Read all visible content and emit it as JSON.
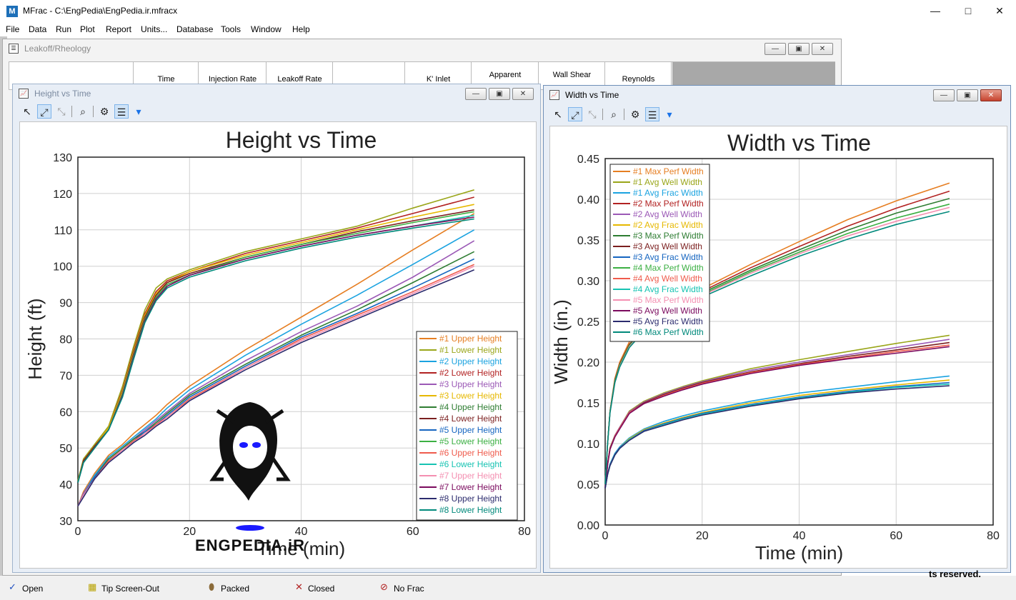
{
  "window": {
    "title": "MFrac - C:\\EngPedia\\EngPedia.ir.mfracx",
    "app_icon": "M"
  },
  "menu": [
    "File",
    "Data",
    "Run",
    "Plot",
    "Report",
    "Units...",
    "Database",
    "Tools",
    "Window",
    "Help"
  ],
  "leakoff": {
    "title": "Leakoff/Rheology",
    "columns": [
      "Time",
      "Injection Rate",
      "Leakoff Rate",
      "",
      "K' Inlet",
      "Apparent",
      "Wall Shear",
      "Reynolds"
    ]
  },
  "height_window": {
    "title": "Height vs Time",
    "chart_data": {
      "type": "line",
      "title": "Height vs Time",
      "xlabel": "Time (min)",
      "ylabel": "Height (ft)",
      "xlim": [
        0,
        80
      ],
      "ylim": [
        30,
        130
      ],
      "xticks": [
        "0",
        "20",
        "40",
        "60",
        "80"
      ],
      "yticks": [
        "30",
        "40",
        "50",
        "60",
        "70",
        "80",
        "90",
        "100",
        "110",
        "120",
        "130"
      ],
      "grid": true,
      "legend_position": "bottom-right",
      "x": [
        0,
        1,
        3,
        5.5,
        8,
        10,
        12,
        14,
        16,
        20,
        30,
        40,
        50,
        60,
        71
      ],
      "series": [
        {
          "name": "#1 Upper Height",
          "color": "#e67e22",
          "values": [
            34,
            38,
            43,
            48,
            51,
            54,
            56.5,
            59,
            62,
            67,
            77,
            86,
            95,
            104.5,
            114.5
          ]
        },
        {
          "name": "#1 Lower Height",
          "color": "#9aa61a",
          "values": [
            41,
            47,
            51,
            56,
            67,
            78,
            88,
            94,
            96.5,
            99,
            104,
            107.5,
            111,
            116,
            121
          ]
        },
        {
          "name": "#2 Upper Height",
          "color": "#1ba3e0",
          "values": [
            34,
            37.5,
            42.5,
            47.5,
            50.5,
            53,
            55.5,
            58,
            61,
            66,
            75.5,
            84,
            92,
            100.5,
            110
          ]
        },
        {
          "name": "#2 Lower Height",
          "color": "#b22222",
          "values": [
            40.5,
            46.5,
            50.5,
            55.5,
            66,
            77,
            87,
            93,
            96,
            98.5,
            103.5,
            107,
            110.5,
            114.5,
            119
          ]
        },
        {
          "name": "#3 Upper Height",
          "color": "#9b59b6",
          "values": [
            34,
            37.5,
            42,
            47,
            50,
            52.5,
            55,
            57.5,
            60,
            65,
            74,
            82,
            89,
            97,
            107
          ]
        },
        {
          "name": "#3 Lower Height",
          "color": "#e6b800",
          "values": [
            40.5,
            46.5,
            50.5,
            55.5,
            65.5,
            76.5,
            86.5,
            92.5,
            95.5,
            98.5,
            103,
            106.5,
            110,
            113.5,
            117
          ]
        },
        {
          "name": "#4 Upper Height",
          "color": "#2e7d32",
          "values": [
            34,
            37,
            42,
            47,
            50,
            52.5,
            54.5,
            57,
            59.5,
            64.5,
            73,
            81,
            88,
            95.5,
            104
          ]
        },
        {
          "name": "#4 Lower Height",
          "color": "#7b1f1f",
          "values": [
            40.5,
            46.5,
            50.5,
            55,
            65,
            76,
            86,
            92,
            95.5,
            98,
            102.5,
            106,
            109.5,
            112.5,
            115.5
          ]
        },
        {
          "name": "#5 Upper Height",
          "color": "#1565c0",
          "values": [
            34,
            37,
            42,
            46.5,
            49.5,
            52,
            54.5,
            56.5,
            59,
            64,
            72.5,
            80.5,
            87,
            94,
            102
          ]
        },
        {
          "name": "#5 Lower Height",
          "color": "#3cb043",
          "values": [
            40.5,
            46,
            50,
            55,
            65,
            75.5,
            85.5,
            91.5,
            95,
            97.5,
            102.5,
            106,
            109,
            112,
            115
          ]
        },
        {
          "name": "#6 Upper Height",
          "color": "#ef5b4c",
          "values": [
            34,
            37,
            41.5,
            46.5,
            49.5,
            52,
            54,
            56.5,
            58.5,
            63.5,
            72,
            80,
            86.5,
            93,
            100.5
          ]
        },
        {
          "name": "#6 Lower Height",
          "color": "#17c3b2",
          "values": [
            40.5,
            46,
            50,
            55,
            64.5,
            75,
            85,
            91,
            94.5,
            97.5,
            102,
            105.5,
            108.5,
            111,
            114
          ]
        },
        {
          "name": "#7 Upper Height",
          "color": "#f48fb1",
          "values": [
            34,
            37,
            41.5,
            46,
            49.5,
            51.5,
            54,
            56,
            58.5,
            63,
            72,
            79.5,
            86,
            92.5,
            100
          ]
        },
        {
          "name": "#7 Lower Height",
          "color": "#7b0a5e",
          "values": [
            40.5,
            46,
            50,
            55,
            64.5,
            75,
            85,
            91,
            94.5,
            97.5,
            102,
            105.5,
            108.5,
            111,
            113.5
          ]
        },
        {
          "name": "#8 Upper Height",
          "color": "#2c2c6e",
          "values": [
            34,
            36.5,
            41.5,
            46,
            49,
            51.5,
            53.5,
            56,
            58,
            63,
            71.5,
            79,
            85.5,
            92,
            99
          ]
        },
        {
          "name": "#8 Lower Height",
          "color": "#00897b",
          "values": [
            40.5,
            46,
            50,
            55,
            64,
            74.5,
            84.5,
            90.5,
            94,
            97,
            101.5,
            105,
            108,
            110.5,
            113
          ]
        }
      ]
    }
  },
  "width_window": {
    "title": "Width vs Time",
    "chart_data": {
      "type": "line",
      "title": "Width vs Time",
      "xlabel": "Time (min)",
      "ylabel": "Width (in.)",
      "xlim": [
        0,
        80
      ],
      "ylim": [
        0,
        0.45
      ],
      "xticks": [
        "0",
        "20",
        "40",
        "60",
        "80"
      ],
      "yticks": [
        "0.00",
        "0.05",
        "0.10",
        "0.15",
        "0.20",
        "0.25",
        "0.30",
        "0.35",
        "0.40",
        "0.45"
      ],
      "grid": true,
      "legend_position": "top-left",
      "x": [
        0,
        0.5,
        1,
        2,
        3,
        5,
        8,
        12,
        16,
        20,
        30,
        40,
        50,
        60,
        71
      ],
      "series": [
        {
          "name": "#1 Max Perf Width",
          "color": "#e67e22",
          "values": [
            0.05,
            0.1,
            0.14,
            0.18,
            0.2,
            0.225,
            0.245,
            0.26,
            0.275,
            0.29,
            0.32,
            0.348,
            0.375,
            0.398,
            0.42
          ]
        },
        {
          "name": "#1 Avg Well Width",
          "color": "#9aa61a",
          "values": [
            0.045,
            0.075,
            0.095,
            0.11,
            0.12,
            0.14,
            0.152,
            0.162,
            0.17,
            0.177,
            0.192,
            0.203,
            0.213,
            0.223,
            0.233
          ]
        },
        {
          "name": "#1 Avg Frac Width",
          "color": "#1ba3e0",
          "values": [
            0.045,
            0.063,
            0.075,
            0.088,
            0.096,
            0.107,
            0.118,
            0.127,
            0.134,
            0.14,
            0.152,
            0.162,
            0.169,
            0.176,
            0.183
          ]
        },
        {
          "name": "#2 Max Perf Width",
          "color": "#b22222",
          "values": [
            0.05,
            0.1,
            0.14,
            0.178,
            0.198,
            0.222,
            0.242,
            0.257,
            0.272,
            0.287,
            0.316,
            0.342,
            0.367,
            0.389,
            0.41
          ]
        },
        {
          "name": "#2 Avg Well Width",
          "color": "#9b59b6",
          "values": [
            0.045,
            0.075,
            0.094,
            0.11,
            0.12,
            0.139,
            0.151,
            0.161,
            0.169,
            0.176,
            0.19,
            0.2,
            0.209,
            0.218,
            0.228
          ]
        },
        {
          "name": "#2 Avg Frac Width",
          "color": "#e6b800",
          "values": [
            0.045,
            0.063,
            0.074,
            0.087,
            0.095,
            0.106,
            0.117,
            0.125,
            0.132,
            0.138,
            0.15,
            0.159,
            0.166,
            0.172,
            0.178
          ]
        },
        {
          "name": "#3 Max Perf Width",
          "color": "#2e7d32",
          "values": [
            0.05,
            0.1,
            0.139,
            0.177,
            0.197,
            0.221,
            0.241,
            0.256,
            0.27,
            0.285,
            0.313,
            0.338,
            0.362,
            0.383,
            0.401
          ]
        },
        {
          "name": "#3 Avg Well Width",
          "color": "#7b1f1f",
          "values": [
            0.045,
            0.075,
            0.094,
            0.109,
            0.119,
            0.138,
            0.15,
            0.16,
            0.168,
            0.175,
            0.188,
            0.198,
            0.207,
            0.215,
            0.224
          ]
        },
        {
          "name": "#3 Avg Frac Width",
          "color": "#1565c0",
          "values": [
            0.045,
            0.062,
            0.074,
            0.087,
            0.095,
            0.105,
            0.116,
            0.124,
            0.131,
            0.137,
            0.148,
            0.157,
            0.164,
            0.17,
            0.175
          ]
        },
        {
          "name": "#4 Max Perf Width",
          "color": "#3cb043",
          "values": [
            0.05,
            0.1,
            0.139,
            0.176,
            0.196,
            0.22,
            0.24,
            0.255,
            0.269,
            0.283,
            0.311,
            0.335,
            0.358,
            0.377,
            0.394
          ]
        },
        {
          "name": "#4 Avg Well Width",
          "color": "#ef5b4c",
          "values": [
            0.045,
            0.074,
            0.093,
            0.109,
            0.119,
            0.138,
            0.149,
            0.159,
            0.167,
            0.174,
            0.187,
            0.197,
            0.205,
            0.213,
            0.221
          ]
        },
        {
          "name": "#4 Avg Frac Width",
          "color": "#17c3b2",
          "values": [
            0.045,
            0.062,
            0.073,
            0.086,
            0.094,
            0.105,
            0.115,
            0.123,
            0.13,
            0.136,
            0.147,
            0.156,
            0.163,
            0.169,
            0.173
          ]
        },
        {
          "name": "#5 Max Perf Width",
          "color": "#f48fb1",
          "values": [
            0.05,
            0.1,
            0.138,
            0.175,
            0.195,
            0.219,
            0.239,
            0.254,
            0.268,
            0.282,
            0.309,
            0.333,
            0.355,
            0.373,
            0.39
          ]
        },
        {
          "name": "#5 Avg Well Width",
          "color": "#7b0a5e",
          "values": [
            0.045,
            0.074,
            0.093,
            0.108,
            0.118,
            0.137,
            0.149,
            0.158,
            0.166,
            0.173,
            0.186,
            0.196,
            0.204,
            0.211,
            0.219
          ]
        },
        {
          "name": "#5 Avg Frac Width",
          "color": "#2c2c6e",
          "values": [
            0.045,
            0.062,
            0.073,
            0.086,
            0.094,
            0.104,
            0.115,
            0.122,
            0.129,
            0.135,
            0.146,
            0.155,
            0.162,
            0.167,
            0.171
          ]
        },
        {
          "name": "#6 Max Perf Width",
          "color": "#00897b",
          "values": [
            0.05,
            0.1,
            0.138,
            0.175,
            0.194,
            0.218,
            0.238,
            0.252,
            0.266,
            0.28,
            0.306,
            0.33,
            0.351,
            0.369,
            0.385
          ]
        }
      ]
    }
  },
  "watermark": {
    "text": "ENGPEDIA.iR",
    "accent": "#1a1aff"
  },
  "statusbar": {
    "items": [
      {
        "icon": "check-icon",
        "glyph": "✓",
        "label": "Open",
        "color": "#1f4fbf"
      },
      {
        "icon": "tip-screenout-icon",
        "glyph": "▦",
        "label": "Tip Screen-Out",
        "color": "#b8a200"
      },
      {
        "icon": "packed-icon",
        "glyph": "⬮",
        "label": "Packed",
        "color": "#8b6b3a"
      },
      {
        "icon": "closed-icon",
        "glyph": "✕",
        "label": "Closed",
        "color": "#b22222"
      },
      {
        "icon": "no-frac-icon",
        "glyph": "⊘",
        "label": "No Frac",
        "color": "#b22222"
      }
    ],
    "right_text": "ts reserved."
  }
}
